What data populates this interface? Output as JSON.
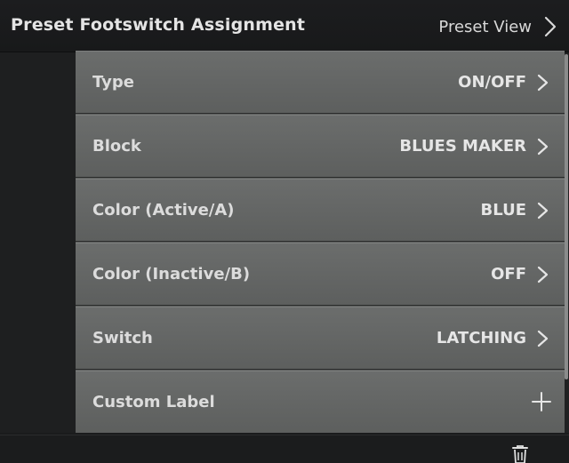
{
  "header": {
    "title": "Preset Footswitch Assignment",
    "action_label": "Preset View",
    "action_icon": "chevron-right-icon"
  },
  "rows": [
    {
      "label": "Type",
      "value": "ON/OFF",
      "icon": "chevron-right-icon"
    },
    {
      "label": "Block",
      "value": "BLUES MAKER",
      "icon": "chevron-right-icon"
    },
    {
      "label": "Color (Active/A)",
      "value": "BLUE",
      "icon": "chevron-right-icon"
    },
    {
      "label": "Color (Inactive/B)",
      "value": "OFF",
      "icon": "chevron-right-icon"
    },
    {
      "label": "Switch",
      "value": "LATCHING",
      "icon": "chevron-right-icon"
    },
    {
      "label": "Custom Label",
      "value": "",
      "icon": "plus-icon"
    }
  ],
  "footer": {
    "icon": "trash-icon"
  },
  "colors": {
    "row_background": "#636564",
    "text": "#e4e4e4",
    "screen_background": "#1a1b1c"
  }
}
